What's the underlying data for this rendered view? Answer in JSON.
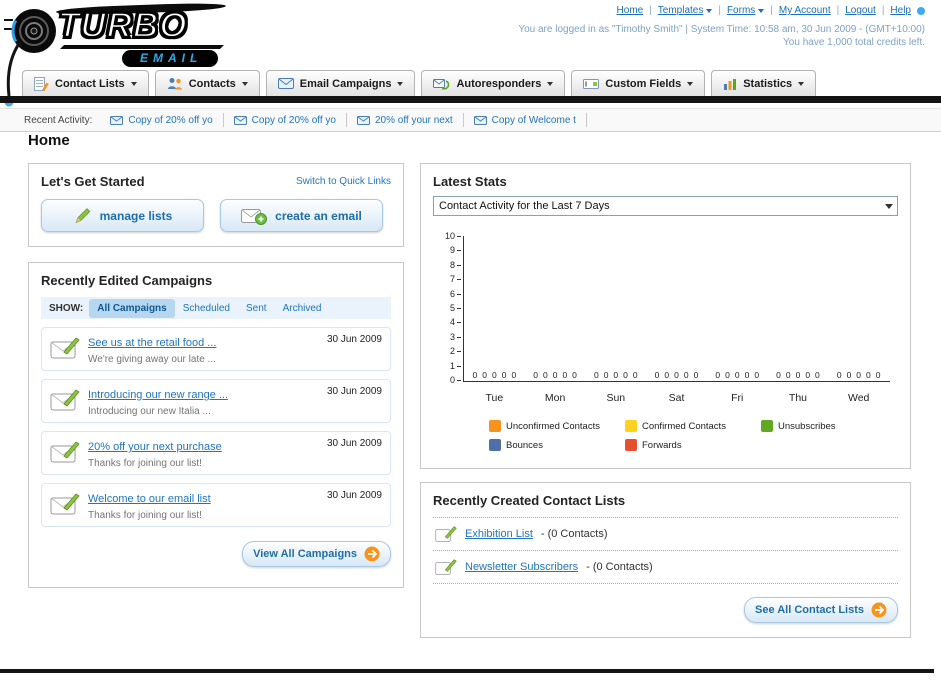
{
  "header": {
    "logo": {
      "line1": "TURBO",
      "line2": "EMAIL"
    },
    "links": [
      {
        "label": "Home",
        "dropdown": false
      },
      {
        "label": "Templates",
        "dropdown": true
      },
      {
        "label": "Forms",
        "dropdown": true
      },
      {
        "label": "My Account",
        "dropdown": false
      },
      {
        "label": "Logout",
        "dropdown": false
      },
      {
        "label": "Help",
        "dropdown": false
      }
    ],
    "login_info": "You are logged in as \"Timothy Smith\" | System Time: 10:58 am, 30 Jun 2009 - (GMT+10:00)",
    "credits_info": "You have 1,000 total credits left."
  },
  "nav": {
    "tabs": [
      {
        "label": "Contact Lists",
        "icon": "contact-lists-icon"
      },
      {
        "label": "Contacts",
        "icon": "contacts-icon"
      },
      {
        "label": "Email Campaigns",
        "icon": "email-campaigns-icon"
      },
      {
        "label": "Autoresponders",
        "icon": "autoresponders-icon"
      },
      {
        "label": "Custom Fields",
        "icon": "custom-fields-icon"
      },
      {
        "label": "Statistics",
        "icon": "statistics-icon"
      }
    ]
  },
  "recent_activity": {
    "label": "Recent Activity:",
    "items": [
      "Copy of 20% off yo",
      "Copy of 20% off yo",
      "20% off your next",
      "Copy of Welcome t"
    ]
  },
  "page": {
    "title": "Home"
  },
  "get_started": {
    "title": "Let's Get Started",
    "switch_link": "Switch to Quick Links",
    "buttons": [
      {
        "label": "manage lists"
      },
      {
        "label": "create an email"
      }
    ]
  },
  "campaigns": {
    "title": "Recently Edited Campaigns",
    "show_label": "SHOW:",
    "filters": [
      "All Campaigns",
      "Scheduled",
      "Sent",
      "Archived"
    ],
    "active_filter": "All Campaigns",
    "items": [
      {
        "title": "See us at the retail food ...",
        "subtitle": "We're giving away our late ...",
        "date": "30 Jun 2009"
      },
      {
        "title": "Introducing our new range ...",
        "subtitle": "Introducing our new Italia ...",
        "date": "30 Jun 2009"
      },
      {
        "title": "20% off your next purchase",
        "subtitle": "Thanks for joining our list!",
        "date": "30 Jun 2009"
      },
      {
        "title": "Welcome to our email list",
        "subtitle": "Thanks for joining our list!",
        "date": "30 Jun 2009"
      }
    ],
    "view_all_label": "View All Campaigns"
  },
  "stats": {
    "title": "Latest Stats",
    "dropdown_value": "Contact Activity for the Last 7 Days"
  },
  "chart_data": {
    "type": "bar",
    "title": "Contact Activity for the Last 7 Days",
    "categories": [
      "Tue",
      "Mon",
      "Sun",
      "Sat",
      "Fri",
      "Thu",
      "Wed"
    ],
    "series": [
      {
        "name": "Unconfirmed Contacts",
        "color": "#F7941D",
        "values": [
          0,
          0,
          0,
          0,
          0,
          0,
          0
        ]
      },
      {
        "name": "Confirmed Contacts",
        "color": "#FFD21E",
        "values": [
          0,
          0,
          0,
          0,
          0,
          0,
          0
        ]
      },
      {
        "name": "Unsubscribes",
        "color": "#61A823",
        "values": [
          0,
          0,
          0,
          0,
          0,
          0,
          0
        ]
      },
      {
        "name": "Bounces",
        "color": "#4F6FA8",
        "values": [
          0,
          0,
          0,
          0,
          0,
          0,
          0
        ]
      },
      {
        "name": "Forwards",
        "color": "#E8502D",
        "values": [
          0,
          0,
          0,
          0,
          0,
          0,
          0
        ]
      }
    ],
    "xlabel": "",
    "ylabel": "",
    "ylim": [
      0,
      10
    ],
    "yticks": [
      10,
      9,
      8,
      7,
      6,
      5,
      4,
      3,
      2,
      1,
      0
    ],
    "grid": false,
    "legend_position": "bottom"
  },
  "contact_lists": {
    "title": "Recently Created Contact Lists",
    "items": [
      {
        "name": "Exhibition List",
        "suffix": " - (0 Contacts)"
      },
      {
        "name": "Newsletter Subscribers",
        "suffix": " - (0 Contacts)"
      }
    ],
    "see_all_label": "See All Contact Lists"
  }
}
